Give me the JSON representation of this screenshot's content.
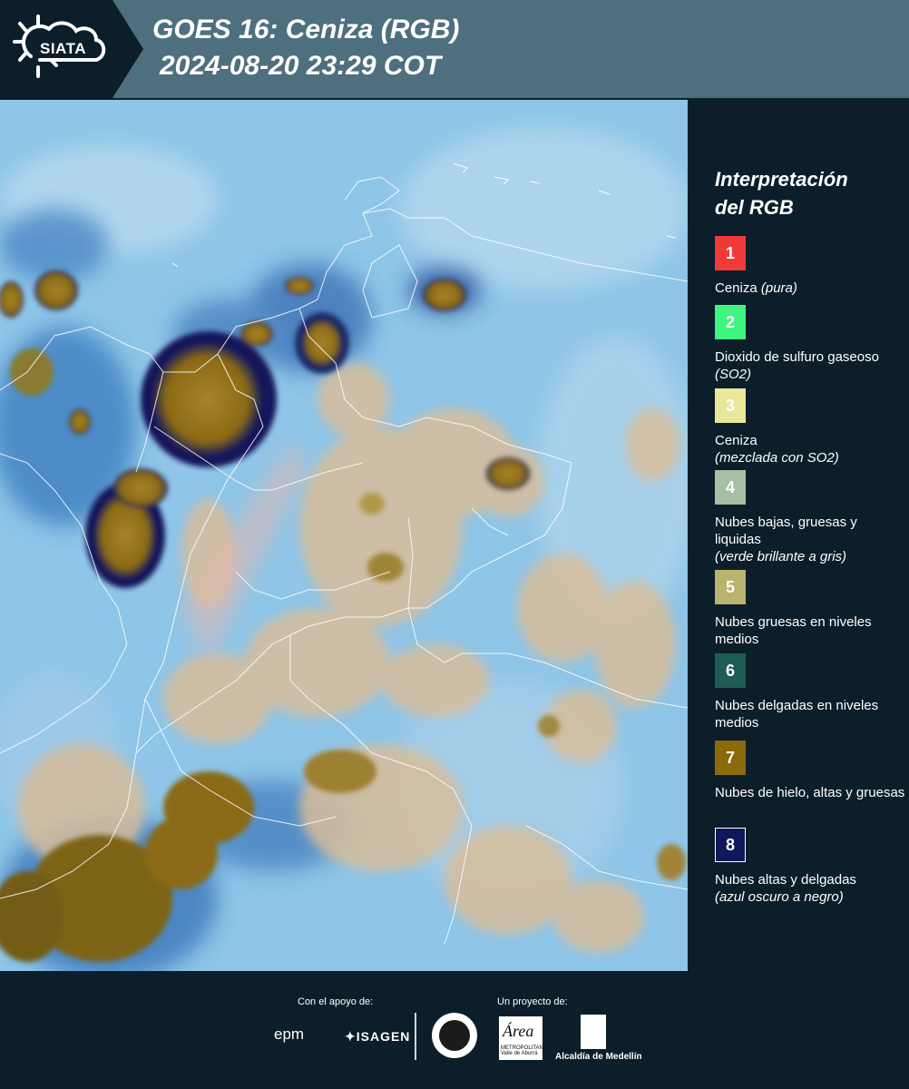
{
  "header": {
    "logo_text": "SIATA",
    "title": "GOES 16: Ceniza (RGB)",
    "subtitle": "2024-08-20 23:29 COT"
  },
  "map": {
    "description_icon": "satellite-rgb-map",
    "base_color": "#8ec5e8"
  },
  "legend": {
    "title_line1": "Interpretación",
    "title_line2": "del RGB",
    "items": [
      {
        "num": "1",
        "color": "#ef3a3a",
        "text": "Ceniza",
        "italic": "(pura)",
        "inline": true
      },
      {
        "num": "2",
        "color": "#3df57f",
        "text": "Dioxido de sulfuro gaseoso",
        "italic": "(SO2)",
        "inline": true
      },
      {
        "num": "3",
        "color": "#e8e79a",
        "text": "Ceniza",
        "italic": "(mezclada con SO2)",
        "inline": false
      },
      {
        "num": "4",
        "color": "#a7bfa5",
        "text": "Nubes bajas, gruesas y liquidas",
        "italic": "(verde brillante a gris)",
        "inline": false
      },
      {
        "num": "5",
        "color": "#b8b46f",
        "text": "Nubes gruesas en niveles medios",
        "italic": "",
        "inline": false
      },
      {
        "num": "6",
        "color": "#1e5c55",
        "text": "Nubes delgadas en niveles medios",
        "italic": "",
        "inline": false
      },
      {
        "num": "7",
        "color": "#8a6a0d",
        "text": "Nubes de hielo, altas y gruesas",
        "italic": "",
        "inline": false
      },
      {
        "num": "8",
        "color": "#11185a",
        "text": "Nubes altas y delgadas",
        "italic": "(azul oscuro a negro)",
        "inline": false
      }
    ]
  },
  "footer": {
    "support_label": "Con el apoyo de:",
    "project_label": "Un proyecto de:",
    "epm": "epm",
    "isagen": "ISAGEN",
    "area_title": "Área",
    "area_sub": "METROPOLITANA Valle de Aburrá",
    "medellin": "Alcaldía de Medellín"
  }
}
